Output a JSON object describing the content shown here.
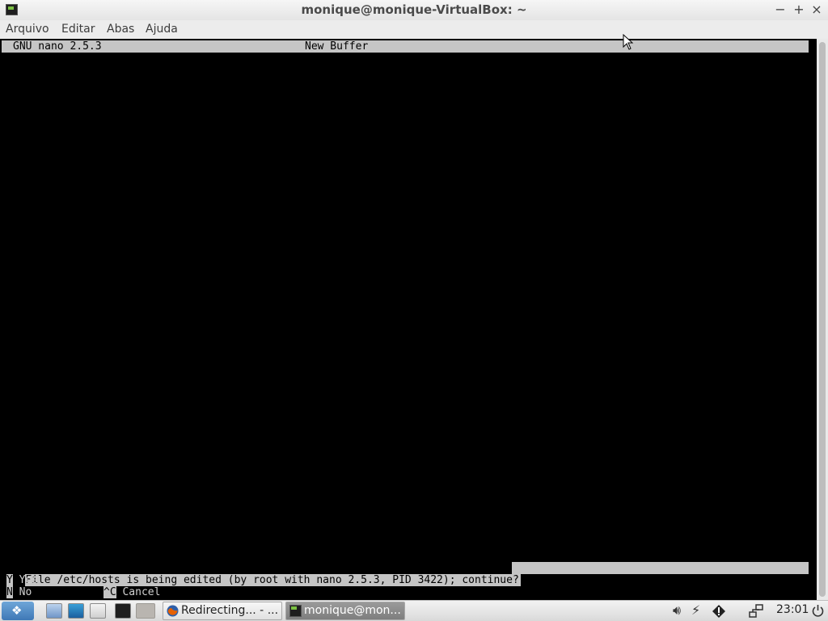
{
  "window": {
    "title": "monique@monique-VirtualBox: ~",
    "minimize_glyph": "−",
    "maximize_glyph": "+",
    "close_glyph": "×"
  },
  "menu": {
    "items": [
      "Arquivo",
      "Editar",
      "Abas",
      "Ajuda"
    ]
  },
  "nano": {
    "version": "GNU nano 2.5.3",
    "buffer": "New Buffer",
    "prompt": "File /etc/hosts is being edited (by root with nano 2.5.3, PID 3422); continue?",
    "options": [
      {
        "key": "Y",
        "label": "Yes"
      },
      {
        "key": "N",
        "label": "No"
      },
      {
        "key": "^C",
        "label": "Cancel"
      }
    ]
  },
  "taskbar": {
    "tasks": [
      {
        "label": "Redirecting... - ..."
      },
      {
        "label": "monique@mon..."
      }
    ],
    "clock": "23:01",
    "tray_icons": [
      "volume-icon",
      "power-icon",
      "warning-icon",
      "network-icon",
      "shutdown-icon"
    ]
  },
  "colors": {
    "terminal_bg": "#000000",
    "nano_bar": "#c5c5c5",
    "firefox_accent": "#e66000",
    "terminal_icon_accent": "#7bc043"
  }
}
